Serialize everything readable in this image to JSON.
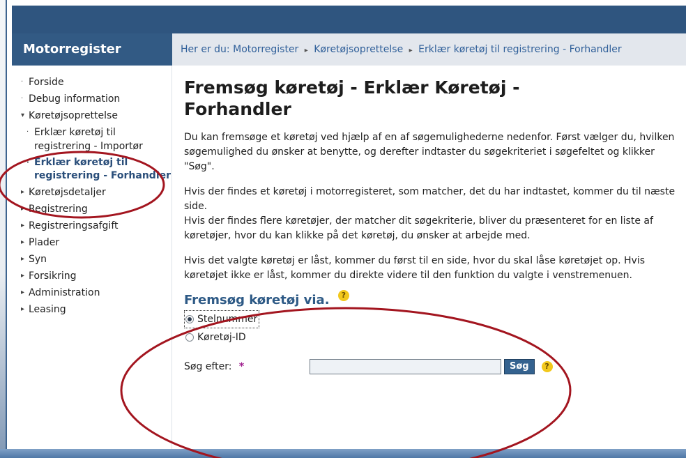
{
  "app": {
    "title": "Motorregister"
  },
  "breadcrumb": {
    "prefix": "Her er du:",
    "items": [
      "Motorregister",
      "Køretøjsoprettelse",
      "Erklær køretøj til registrering - Forhandler"
    ]
  },
  "sidebar": {
    "items": [
      {
        "label": "Forside",
        "bullet": "·"
      },
      {
        "label": "Debug information",
        "bullet": "·"
      },
      {
        "label": "Køretøjsoprettelse",
        "bullet": "▾"
      },
      {
        "label": "Erklær køretøj til registrering - Importør",
        "bullet": "·",
        "sub": true
      },
      {
        "label": "Erklær køretøj til registrering - Forhandler",
        "bullet": "·",
        "sub": true,
        "active": true
      },
      {
        "label": "Køretøjsdetaljer",
        "bullet": "▸"
      },
      {
        "label": "Registrering",
        "bullet": "▸"
      },
      {
        "label": "Registreringsafgift",
        "bullet": "▸"
      },
      {
        "label": "Plader",
        "bullet": "▸"
      },
      {
        "label": "Syn",
        "bullet": "▸"
      },
      {
        "label": "Forsikring",
        "bullet": "▸"
      },
      {
        "label": "Administration",
        "bullet": "▸"
      },
      {
        "label": "Leasing",
        "bullet": "▸"
      }
    ]
  },
  "main": {
    "title": "Fremsøg køretøj - Erklær Køretøj - Forhandler",
    "para1": "Du kan fremsøge et køretøj ved hjælp af en af søgemulighederne nedenfor. Først vælger du, hvilken søgemulighed du ønsker at benytte, og derefter indtaster du søgekriteriet i søgefeltet og klikker \"Søg\".",
    "para2a": "Hvis der findes et køretøj i motorregisteret, som matcher, det du har indtastet, kommer du til næste side.",
    "para2b": "Hvis der findes flere køretøjer, der matcher dit søgekriterie, bliver du præsenteret for en liste af køretøjer, hvor du kan klikke på det køretøj, du ønsker at arbejde med.",
    "para3": "Hvis det valgte køretøj er låst, kommer du først til en side, hvor du skal låse køretøjet op. Hvis køretøjet ikke er låst, kommer du direkte videre til den funktion du valgte i venstremenuen.",
    "search_title": "Fremsøg køretøj via.",
    "help_glyph": "?",
    "options": [
      {
        "label": "Stelnummer",
        "checked": true
      },
      {
        "label": "Køretøj-ID",
        "checked": false
      }
    ],
    "search_label": "Søg efter:",
    "required_mark": "*",
    "search_value": "",
    "search_button": "Søg"
  },
  "colors": {
    "header": "#325a84",
    "breadcrumb_bg": "#e3e7ed",
    "link": "#2f5f99",
    "annotation": "#a3151f"
  },
  "icons": [
    "help-icon",
    "radio-selected",
    "radio-unselected",
    "bullet-dot",
    "triangle-right-icon",
    "triangle-down-icon"
  ]
}
